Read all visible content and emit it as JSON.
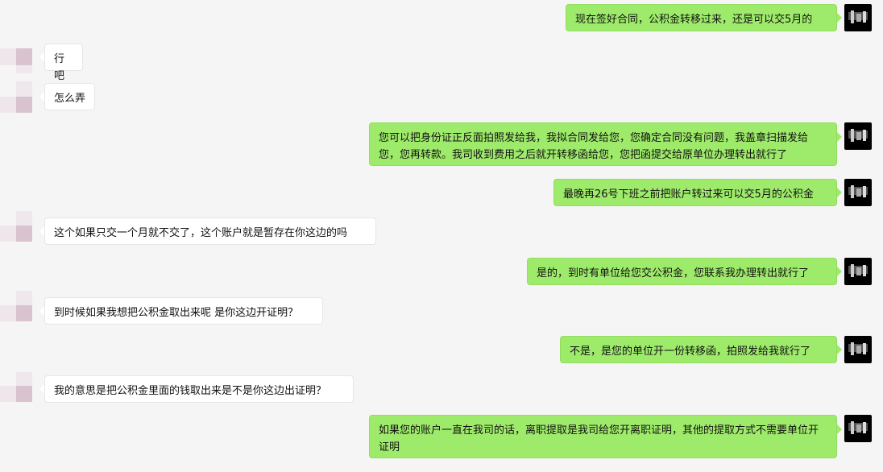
{
  "colors": {
    "background": "#f5f5f5",
    "incoming_bubble": "#ffffff",
    "outgoing_bubble": "#9eea6a"
  },
  "icons": {
    "incoming_avatar": "blurred-avatar-icon",
    "outgoing_avatar": "dark-photo-avatar-icon"
  },
  "messages": [
    {
      "side": "out",
      "text": "现在签好合同，公积金转移过来，还是可以交5月的"
    },
    {
      "side": "in",
      "text": "行吧"
    },
    {
      "side": "in",
      "text": "怎么弄"
    },
    {
      "side": "out",
      "text": "您可以把身份证正反面拍照发给我，我拟合同发给您，您确定合同没有问题，我盖章扫描发给您，您再转款。我司收到费用之后就开转移函给您，您把函提交给原单位办理转出就行了"
    },
    {
      "side": "out",
      "text": "最晚再26号下班之前把账户转过来可以交5月的公积金"
    },
    {
      "side": "in",
      "text": "这个如果只交一个月就不交了，这个账户就是暂存在你这边的吗"
    },
    {
      "side": "out",
      "text": "是的，到时有单位给您交公积金，您联系我办理转出就行了"
    },
    {
      "side": "in",
      "text": "到时候如果我想把公积金取出来呢 是你这边开证明？"
    },
    {
      "side": "out",
      "text": "不是，是您的单位开一份转移函，拍照发给我就行了"
    },
    {
      "side": "in",
      "text": "我的意思是把公积金里面的钱取出来是不是你这边出证明？"
    },
    {
      "side": "out",
      "text": "如果您的账户一直在我司的话，离职提取是我司给您开离职证明，其他的提取方式不需要单位开证明"
    }
  ]
}
